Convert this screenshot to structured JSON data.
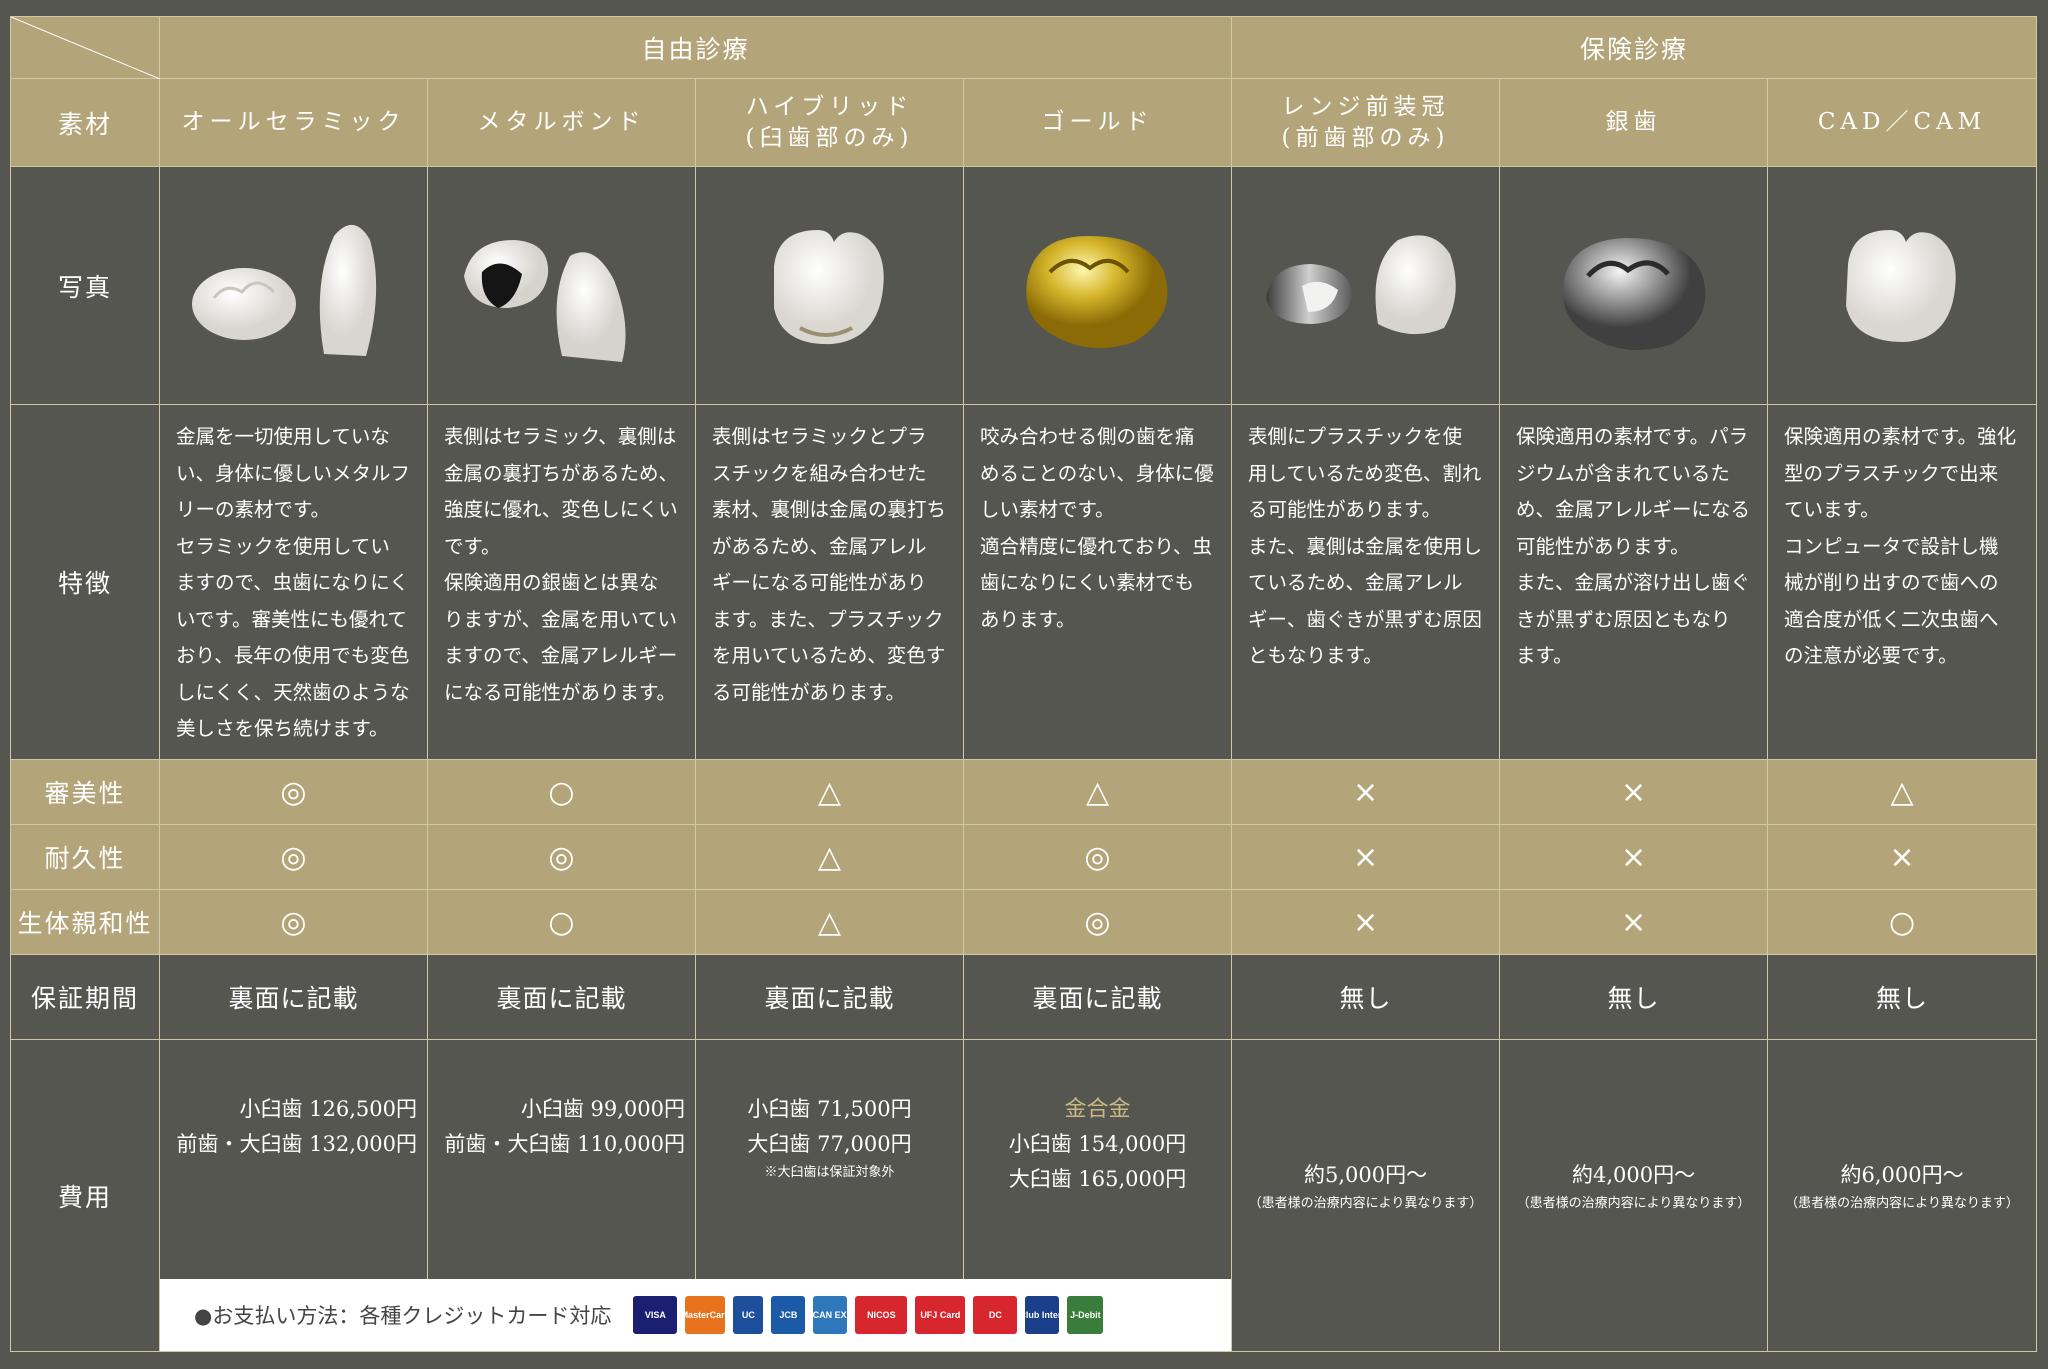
{
  "header": {
    "free": "自由診療",
    "insurance": "保険診療"
  },
  "row_labels": {
    "material": "素材",
    "photo": "写真",
    "features": "特徴",
    "aesthetics": "審美性",
    "durability": "耐久性",
    "biocompat": "生体親和性",
    "warranty": "保証期間",
    "cost": "費用"
  },
  "columns": [
    {
      "name": [
        "オールセラミック"
      ],
      "features": [
        "金属を一切使用していな",
        "い、身体に優しいメタルフ",
        "リーの素材です。",
        "セラミックを使用してい",
        "ますので、虫歯になりにく",
        "いです。審美性にも優れて",
        "おり、長年の使用でも変色",
        "しにくく、天然歯のような",
        "美しさを保ち続けます。"
      ],
      "aesthetics": "◎",
      "durability": "◎",
      "biocompat": "◎",
      "warranty": "裏面に記載",
      "cost": [
        "小臼歯 126,500円",
        "前歯・大臼歯 132,000円"
      ]
    },
    {
      "name": [
        "メタルボンド"
      ],
      "features": [
        "表側はセラミック、裏側は",
        "金属の裏打ちがあるため、",
        "強度に優れ、変色しにくい",
        "です。",
        "保険適用の銀歯とは異な",
        "りますが、金属を用いてい",
        "ますので、金属アレルギー",
        "になる可能性があります。"
      ],
      "aesthetics": "○",
      "durability": "◎",
      "biocompat": "○",
      "warranty": "裏面に記載",
      "cost": [
        "小臼歯 99,000円",
        "前歯・大臼歯 110,000円"
      ]
    },
    {
      "name": [
        "ハイブリッド",
        "(臼歯部のみ)"
      ],
      "features": [
        "表側はセラミックとプラ",
        "スチックを組み合わせた",
        "素材、裏側は金属の裏打ち",
        "があるため、金属アレル",
        "ギーになる可能性があり",
        "ます。また、プラスチック",
        "を用いているため、変色す",
        "る可能性があります。"
      ],
      "aesthetics": "△",
      "durability": "△",
      "biocompat": "△",
      "warranty": "裏面に記載",
      "cost": [
        "小臼歯 71,500円",
        "大臼歯 77,000円"
      ],
      "cost_note": "※大臼歯は保証対象外"
    },
    {
      "name": [
        "ゴールド"
      ],
      "features": [
        "咬み合わせる側の歯を痛",
        "めることのない、身体に優",
        "しい素材です。",
        "適合精度に優れており、虫",
        "歯になりにくい素材でも",
        "あります。"
      ],
      "aesthetics": "△",
      "durability": "◎",
      "biocompat": "◎",
      "warranty": "裏面に記載",
      "cost_label": "金合金",
      "cost": [
        "小臼歯 154,000円",
        "大臼歯 165,000円"
      ]
    },
    {
      "name": [
        "レンジ前装冠",
        "(前歯部のみ)"
      ],
      "features": [
        "表側にプラスチックを使",
        "用しているため変色、割れ",
        "る可能性があります。",
        "また、裏側は金属を使用し",
        "ているため、金属アレル",
        "ギー、歯ぐきが黒ずむ原因",
        "ともなります。"
      ],
      "aesthetics": "×",
      "durability": "×",
      "biocompat": "×",
      "warranty": "無し",
      "cost": [
        "約5,000円～"
      ],
      "cost_note": "（患者様の治療内容により異なります）"
    },
    {
      "name": [
        "銀歯"
      ],
      "features": [
        "保険適用の素材です。パラ",
        "ジウムが含まれているた",
        "め、金属アレルギーになる",
        "可能性があります。",
        "また、金属が溶け出し歯ぐ",
        "きが黒ずむ原因ともなり",
        "ます。"
      ],
      "aesthetics": "×",
      "durability": "×",
      "biocompat": "×",
      "warranty": "無し",
      "cost": [
        "約4,000円～"
      ],
      "cost_note": "（患者様の治療内容により異なります）"
    },
    {
      "name": [
        "CAD／CAM"
      ],
      "features": [
        "保険適用の素材です。強化",
        "型のプラスチックで出来",
        "ています。",
        "コンピュータで設計し機",
        "械が削り出すので歯への",
        "適合度が低く二次虫歯へ",
        "の注意が必要です。"
      ],
      "aesthetics": "△",
      "durability": "×",
      "biocompat": "○",
      "warranty": "無し",
      "cost": [
        "約6,000円～"
      ],
      "cost_note": "（患者様の治療内容により異なります）"
    }
  ],
  "payment": {
    "text": "●お支払い方法：各種クレジットカード対応",
    "cards": [
      {
        "label": "VISA",
        "color": "#1a1f71"
      },
      {
        "label": "MasterCard",
        "color": "#e8731d"
      },
      {
        "label": "UC",
        "color": "#1d4f9c"
      },
      {
        "label": "JCB",
        "color": "#1a5aa6"
      },
      {
        "label": "AMERICAN EXPRESS",
        "color": "#2e77bb"
      },
      {
        "label": "NICOS",
        "color": "#d7262e"
      },
      {
        "label": "UFJ Card",
        "color": "#d7262e"
      },
      {
        "label": "DC",
        "color": "#d7262e"
      },
      {
        "label": "Diners Club International",
        "color": "#1c3f8c"
      },
      {
        "label": "J-Debit",
        "color": "#3a7d3b"
      }
    ]
  },
  "colors": {
    "gold": "#b3a579",
    "dark": "#55564f",
    "border": "#cfc7a6"
  }
}
